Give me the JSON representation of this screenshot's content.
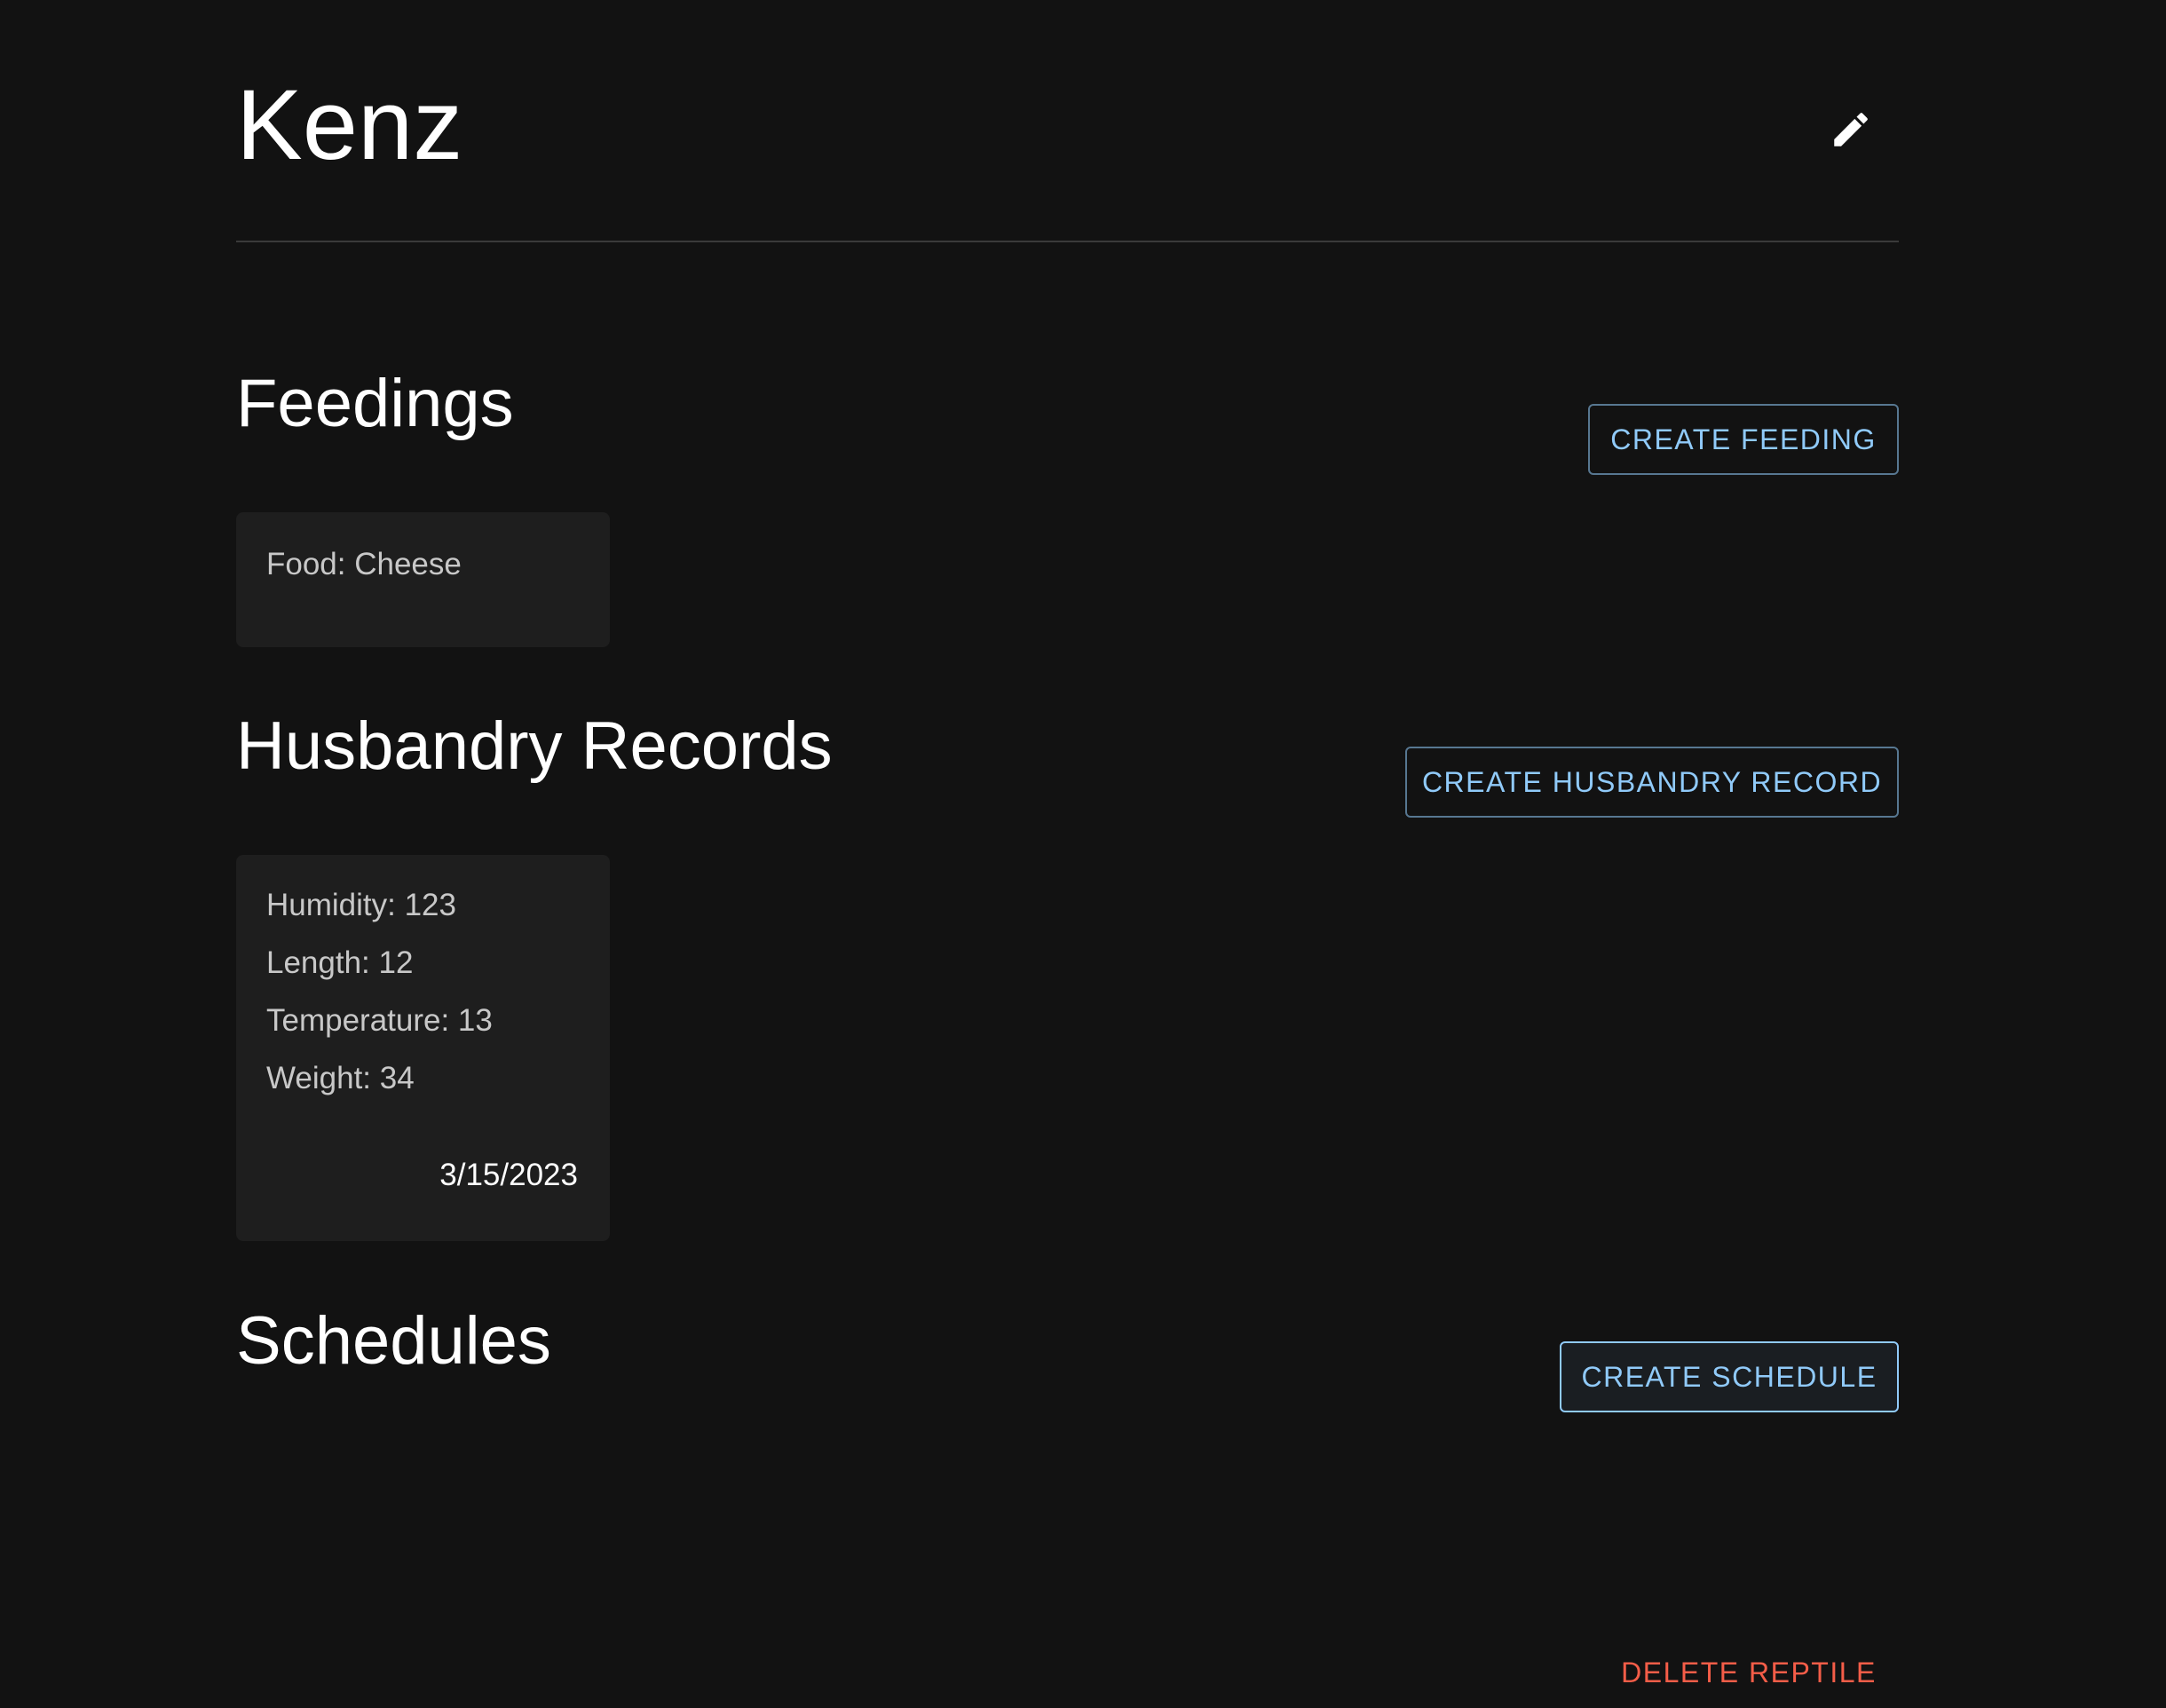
{
  "reptile": {
    "name": "Kenz",
    "edit_icon": "pencil-icon"
  },
  "feedings": {
    "title": "Feedings",
    "create_label": "CREATE FEEDING",
    "items": [
      {
        "food_label": "Food: Cheese"
      }
    ]
  },
  "husbandry": {
    "title": "Husbandry Records",
    "create_label": "CREATE HUSBANDRY RECORD",
    "items": [
      {
        "humidity": "Humidity: 123",
        "length": "Length: 12",
        "temperature": "Temperature: 13",
        "weight": "Weight: 34",
        "date": "3/15/2023"
      }
    ]
  },
  "schedules": {
    "title": "Schedules",
    "create_label": "CREATE SCHEDULE"
  },
  "actions": {
    "delete_label": "DELETE REPTILE"
  },
  "colors": {
    "background": "#121212",
    "card": "#1e1e1e",
    "primary": "#90caf9",
    "danger": "#f45d48"
  }
}
